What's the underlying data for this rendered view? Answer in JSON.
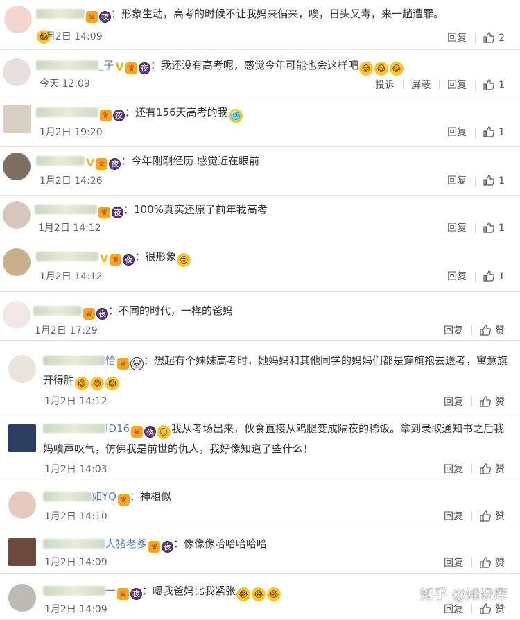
{
  "comments": [
    {
      "name": "",
      "badges": [
        "crown",
        "night"
      ],
      "text": "：形象生动，高考的时候不让我妈来偏来，唉，日头又毒，来一趟遭罪。",
      "emoji_after": [
        "😂"
      ],
      "time": "1月2日 14:09",
      "reply": "回复",
      "likes": "2",
      "actions": []
    },
    {
      "name": "_子",
      "badges": [
        "v",
        "crown",
        "night"
      ],
      "text": "：我还没有高考呢，感觉今年可能也会这样吧",
      "emoji_after": [
        "😂",
        "😂",
        "😂"
      ],
      "time": "今天 12:09",
      "reply": "回复",
      "likes": "1",
      "actions": [
        "投诉",
        "屏蔽"
      ]
    },
    {
      "name": "",
      "badges": [
        "crown",
        "night"
      ],
      "text": "：还有156天高考的我",
      "emoji_after": [
        "🥶"
      ],
      "time": "1月2日 19:20",
      "reply": "回复",
      "likes": "1",
      "actions": []
    },
    {
      "name": "",
      "badges": [
        "v",
        "crown",
        "night"
      ],
      "text": "：今年刚刚经历 感觉近在眼前",
      "emoji_after": [],
      "time": "1月2日 14:26",
      "reply": "回复",
      "likes": "1",
      "actions": []
    },
    {
      "name": "",
      "badges": [
        "crown",
        "night"
      ],
      "text": "：100%真实还原了前年我高考",
      "emoji_after": [],
      "time": "1月2日 14:12",
      "reply": "回复",
      "likes": "1",
      "actions": []
    },
    {
      "name": "",
      "badges": [
        "v",
        "crown",
        "night"
      ],
      "text": "：很形象",
      "emoji_after": [
        "😵"
      ],
      "time": "1月2日 14:12",
      "reply": "回复",
      "likes": "1",
      "actions": []
    },
    {
      "name": "",
      "badges": [
        "crown",
        "night"
      ],
      "text": "：不同的时代，一样的爸妈",
      "emoji_after": [],
      "time": "1月2日 17:29",
      "reply": "回复",
      "likes": "赞",
      "actions": []
    },
    {
      "name": "恰",
      "badges": [
        "crown",
        "panda"
      ],
      "text": "：想起有个妹妹高考时，她妈妈和其他同学的妈妈们都是穿旗袍去送考，寓意旗开得胜",
      "emoji_after": [
        "😂",
        "😂",
        "😂"
      ],
      "time": "1月2日 14:12",
      "reply": "回复",
      "likes": "赞",
      "actions": []
    },
    {
      "name": "ID16",
      "badges": [
        "crown",
        "night"
      ],
      "text": "我从考场出来，伙食直接从鸡腿变成隔夜的稀饭。拿到录取通知书之后我妈唉声叹气，仿佛我是前世的仇人，我好像知道了些什么！",
      "emoji_before": [
        "😏"
      ],
      "emoji_after": [],
      "time": "1月2日 14:03",
      "reply": "回复",
      "likes": "赞",
      "actions": []
    },
    {
      "name": "如YQ",
      "badges": [
        "crown"
      ],
      "text": "：神相似",
      "emoji_after": [],
      "time": "1月2日 14:10",
      "reply": "回复",
      "likes": "赞",
      "actions": []
    },
    {
      "name": "大猪老爹",
      "badges": [
        "crown",
        "night"
      ],
      "text": "：像像像哈哈哈哈哈",
      "emoji_after": [],
      "time": "1月2日 14:09",
      "reply": "回复",
      "likes": "赞",
      "actions": []
    },
    {
      "name": "一",
      "badges": [
        "crown",
        "night"
      ],
      "text": "：嗯我爸妈比我紧张",
      "emoji_after": [
        "😂",
        "😂",
        "😂"
      ],
      "time": "1月2日 14:09",
      "reply": "回复",
      "likes": "赞",
      "actions": []
    }
  ],
  "watermark": "知乎 @知识库",
  "colors": {
    "username": "#5b7fb4",
    "divider": "#e4e4e4",
    "emoji": "#f7c531"
  }
}
